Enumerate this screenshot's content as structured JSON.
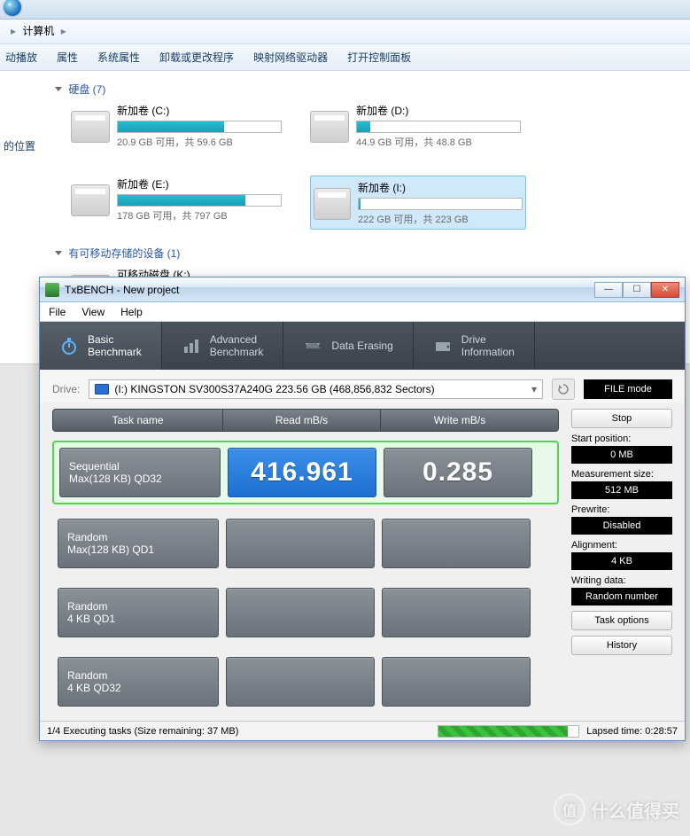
{
  "explorer": {
    "breadcrumb": {
      "root": "计算机",
      "arrow": "▸"
    },
    "toolbar": {
      "autoplay": "动播放",
      "properties": "属性",
      "system_properties": "系统属性",
      "uninstall_change": "卸载或更改程序",
      "map_network": "映射网络驱动器",
      "open_control_panel": "打开控制面板"
    },
    "sidebar": {
      "location": "的位置"
    },
    "sections": {
      "disks": {
        "title": "硬盘 (7)"
      },
      "removable": {
        "title": "有可移动存储的设备 (1)"
      }
    },
    "drives": [
      {
        "label": "新加卷 (C:)",
        "info": "20.9 GB 可用，共 59.6 GB",
        "fill": 65
      },
      {
        "label": "新加卷 (D:)",
        "info": "44.9 GB 可用，共 48.8 GB",
        "fill": 8
      },
      {
        "label": "新加卷 (E:)",
        "info": "178 GB 可用，共 797 GB",
        "fill": 78
      },
      {
        "label": "新加卷 (I:)",
        "info": "222 GB 可用，共 223 GB",
        "fill": 1,
        "selected": true
      }
    ],
    "removable_drive": {
      "label": "可移动磁盘 (K:)",
      "fill": 0
    }
  },
  "txbench": {
    "title": "TxBENCH - New project",
    "menu": {
      "file": "File",
      "view": "View",
      "help": "Help"
    },
    "tabs": {
      "basic": {
        "l1": "Basic",
        "l2": "Benchmark"
      },
      "advanced": {
        "l1": "Advanced",
        "l2": "Benchmark"
      },
      "erasing": {
        "label": "Data Erasing"
      },
      "info": {
        "l1": "Drive",
        "l2": "Information"
      }
    },
    "drive_row": {
      "label": "Drive:",
      "value": "(I:) KINGSTON SV300S37A240G  223.56 GB (468,856,832 Sectors)",
      "file_mode": "FILE mode"
    },
    "headers": {
      "task": "Task name",
      "read": "Read mB/s",
      "write": "Write mB/s"
    },
    "tasks": [
      {
        "name_l1": "Sequential",
        "name_l2": "Max(128 KB) QD32",
        "read": "416.961",
        "write": "0.285",
        "active": true
      },
      {
        "name_l1": "Random",
        "name_l2": "Max(128 KB) QD1",
        "read": "",
        "write": ""
      },
      {
        "name_l1": "Random",
        "name_l2": "4 KB QD1",
        "read": "",
        "write": ""
      },
      {
        "name_l1": "Random",
        "name_l2": "4 KB QD32",
        "read": "",
        "write": ""
      }
    ],
    "side": {
      "stop": "Stop",
      "start_pos_label": "Start position:",
      "start_pos": "0 MB",
      "meas_label": "Measurement size:",
      "meas": "512 MB",
      "prewrite_label": "Prewrite:",
      "prewrite": "Disabled",
      "align_label": "Alignment:",
      "align": "4 KB",
      "writing_label": "Writing data:",
      "writing": "Random number",
      "task_options": "Task options",
      "history": "History"
    },
    "status": {
      "text": "1/4 Executing tasks (Size remaining: 37 MB)",
      "lapsed_label": "Lapsed time:",
      "lapsed": "0:28:57"
    }
  },
  "watermark": {
    "text": "什么值得买",
    "badge": "值"
  }
}
